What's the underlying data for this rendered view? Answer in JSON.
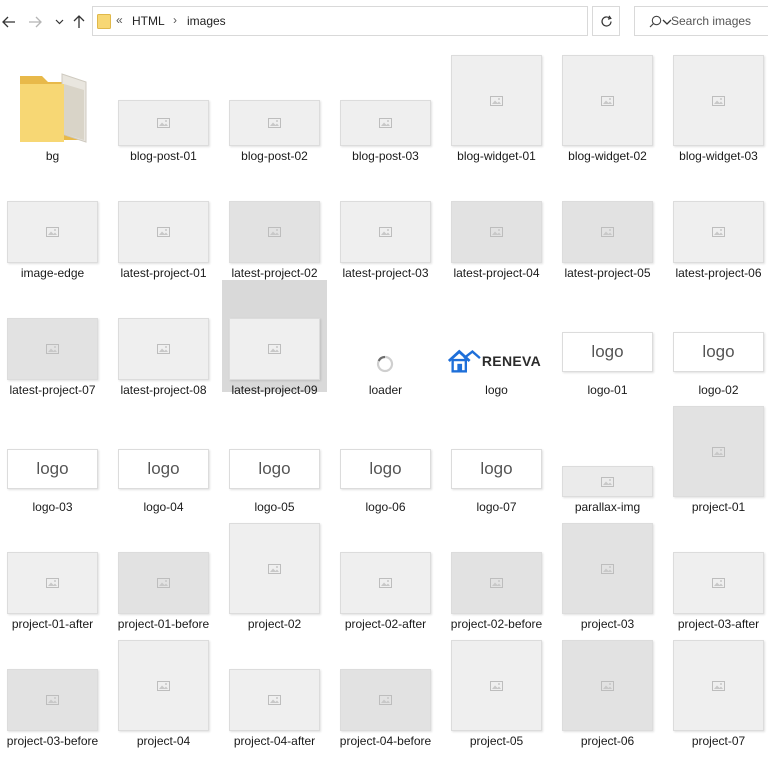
{
  "address": {
    "overflow": "«",
    "crumbs": [
      "HTML",
      "images"
    ]
  },
  "search": {
    "placeholder": "Search images"
  },
  "items": [
    {
      "label": "bg",
      "kind": "folder"
    },
    {
      "label": "blog-post-01",
      "kind": "wide",
      "fill": "#efefef"
    },
    {
      "label": "blog-post-02",
      "kind": "wide",
      "fill": "#efefef"
    },
    {
      "label": "blog-post-03",
      "kind": "wide",
      "fill": "#efefef"
    },
    {
      "label": "blog-widget-01",
      "kind": "square",
      "fill": "#efefef"
    },
    {
      "label": "blog-widget-02",
      "kind": "square",
      "fill": "#efefef"
    },
    {
      "label": "blog-widget-03",
      "kind": "square",
      "fill": "#efefef"
    },
    {
      "label": "image-edge",
      "kind": "std",
      "fill": "#efefef"
    },
    {
      "label": "latest-project-01",
      "kind": "std",
      "fill": "#efefef"
    },
    {
      "label": "latest-project-02",
      "kind": "std",
      "fill": "#e2e2e2"
    },
    {
      "label": "latest-project-03",
      "kind": "std",
      "fill": "#efefef"
    },
    {
      "label": "latest-project-04",
      "kind": "std",
      "fill": "#e2e2e2"
    },
    {
      "label": "latest-project-05",
      "kind": "std",
      "fill": "#e2e2e2"
    },
    {
      "label": "latest-project-06",
      "kind": "std",
      "fill": "#efefef"
    },
    {
      "label": "latest-project-07",
      "kind": "std",
      "fill": "#e2e2e2"
    },
    {
      "label": "latest-project-08",
      "kind": "std",
      "fill": "#efefef"
    },
    {
      "label": "latest-project-09",
      "kind": "std",
      "fill": "#efefef",
      "selected": true
    },
    {
      "label": "loader",
      "kind": "loader"
    },
    {
      "label": "logo",
      "kind": "brand",
      "brand_text": "RENEVA"
    },
    {
      "label": "logo-01",
      "kind": "logo",
      "logo_text": "logo"
    },
    {
      "label": "logo-02",
      "kind": "logo",
      "logo_text": "logo"
    },
    {
      "label": "logo-03",
      "kind": "logo",
      "logo_text": "logo"
    },
    {
      "label": "logo-04",
      "kind": "logo",
      "logo_text": "logo"
    },
    {
      "label": "logo-05",
      "kind": "logo",
      "logo_text": "logo"
    },
    {
      "label": "logo-06",
      "kind": "logo",
      "logo_text": "logo"
    },
    {
      "label": "logo-07",
      "kind": "logo",
      "logo_text": "logo"
    },
    {
      "label": "parallax-img",
      "kind": "short",
      "fill": "#ebebeb"
    },
    {
      "label": "project-01",
      "kind": "square",
      "fill": "#e2e2e2"
    },
    {
      "label": "project-01-after",
      "kind": "std",
      "fill": "#efefef"
    },
    {
      "label": "project-01-before",
      "kind": "std",
      "fill": "#e2e2e2"
    },
    {
      "label": "project-02",
      "kind": "square",
      "fill": "#efefef"
    },
    {
      "label": "project-02-after",
      "kind": "std",
      "fill": "#efefef"
    },
    {
      "label": "project-02-before",
      "kind": "std",
      "fill": "#e2e2e2"
    },
    {
      "label": "project-03",
      "kind": "square",
      "fill": "#e2e2e2"
    },
    {
      "label": "project-03-after",
      "kind": "std",
      "fill": "#efefef"
    },
    {
      "label": "project-03-before",
      "kind": "std",
      "fill": "#e2e2e2"
    },
    {
      "label": "project-04",
      "kind": "square",
      "fill": "#efefef"
    },
    {
      "label": "project-04-after",
      "kind": "std",
      "fill": "#efefef"
    },
    {
      "label": "project-04-before",
      "kind": "std",
      "fill": "#e2e2e2"
    },
    {
      "label": "project-05",
      "kind": "square",
      "fill": "#efefef"
    },
    {
      "label": "project-06",
      "kind": "square",
      "fill": "#e2e2e2"
    },
    {
      "label": "project-07",
      "kind": "square",
      "fill": "#efefef"
    }
  ],
  "colors": {
    "brand_blue": "#1e6fd9",
    "folder_yellow": "#f7d774",
    "selection": "#d9d9d9"
  }
}
